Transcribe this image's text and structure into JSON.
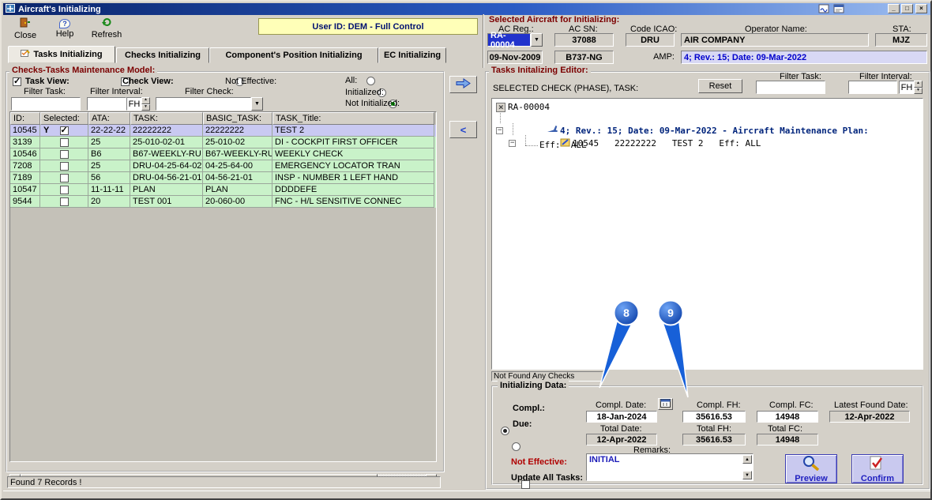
{
  "window": {
    "title": "Aircraft's Initializing"
  },
  "icons": {
    "dropdown": "▼",
    "up": "▲",
    "down": "▼",
    "left": "◄",
    "right": "►",
    "minimize": "_",
    "maximize": "□",
    "close": "×",
    "help": "?"
  },
  "toolbar": {
    "close": "Close",
    "help": "Help",
    "refresh": "Refresh",
    "banner": "User ID: DEM - Full Control"
  },
  "aircraft": {
    "title": "Selected Aircraft for Initializing:",
    "labels": {
      "ac_reg": "AC Reg.:",
      "ac_sn": "AC SN:",
      "code_icao": "Code ICAO:",
      "operator": "Operator Name:",
      "sta": "STA:",
      "amp": "AMP:"
    },
    "values": {
      "ac_reg": "RA-00004",
      "ac_sn": "37088",
      "code_icao": "DRU",
      "operator": "AIR COMPANY",
      "sta": "MJZ",
      "date": "09-Nov-2009",
      "actype": "B737-NG",
      "amp": "4; Rev.: 15; Date: 09-Mar-2022"
    }
  },
  "tabs": {
    "t1": "Tasks Initializing",
    "t2": "Checks Initializing",
    "t3": "Component's Position Initializing",
    "t4": "EC Initializing"
  },
  "model": {
    "title": "Checks-Tasks Maintenance Model:",
    "task_view": "Task View:",
    "check_view": "Check View:",
    "not_effective": "Not Effective:",
    "all": "All:",
    "initialized": "Initialized:",
    "not_initialized": "Not Initialized:",
    "filter_task": "Filter Task:",
    "filter_interval": "Filter Interval:",
    "filter_check": "Filter Check:",
    "fh": "FH",
    "cols": [
      "ID:",
      "Selected:",
      "ATA:",
      "TASK:",
      "BASIC_TASK:",
      "TASK_Title:"
    ],
    "rows": [
      {
        "id": "10545",
        "y": "Y",
        "ata": "22-22-22",
        "task": "22222222",
        "basic": "22222222",
        "title": "TEST 2"
      },
      {
        "id": "3139",
        "y": "",
        "ata": "25",
        "task": "25-010-02-01",
        "basic": "25-010-02",
        "title": "DI - COCKPIT FIRST OFFICER"
      },
      {
        "id": "10546",
        "y": "",
        "ata": "B6",
        "task": "B67-WEEKLY-RU",
        "basic": "B67-WEEKLY-RU",
        "title": "WEEKLY CHECK"
      },
      {
        "id": "7208",
        "y": "",
        "ata": "25",
        "task": "DRU-04-25-64-02",
        "basic": "04-25-64-00",
        "title": "EMERGENCY LOCATOR TRAN"
      },
      {
        "id": "7189",
        "y": "",
        "ata": "56",
        "task": "DRU-04-56-21-01",
        "basic": "04-56-21-01",
        "title": "INSP - NUMBER 1 LEFT HAND"
      },
      {
        "id": "10547",
        "y": "",
        "ata": "11-11-11",
        "task": "PLAN",
        "basic": "PLAN",
        "title": "DDDDEFE"
      },
      {
        "id": "9544",
        "y": "",
        "ata": "20",
        "task": "TEST 001",
        "basic": "20-060-00",
        "title": "FNC - H/L SENSITIVE CONNEC"
      }
    ],
    "status": "Found 7 Records !"
  },
  "mid": {
    "left": "<"
  },
  "editor": {
    "title": "Tasks Initalizing Editor:",
    "selected_label": "SELECTED CHECK (PHASE), TASK:",
    "reset": "Reset",
    "filter_task": "Filter Task:",
    "filter_interval": "Filter Interval:",
    "fh": "FH",
    "tree": {
      "root": "RA-00004",
      "plan": "4; Rev.: 15; Date: 09-Mar-2022 - Aircraft Maintenance Plan:",
      "task": "10545   22222222   TEST 2   Eff: ALL",
      "eff": "Eff:  ALL"
    },
    "not_found": "Not Found Any Checks",
    "init": {
      "title": "Initializing Data:",
      "compl": "Compl.:",
      "due": "Due:",
      "compl_date_label": "Compl. Date:",
      "compl_fh_label": "Compl. FH:",
      "compl_fc_label": "Compl. FC:",
      "latest_label": "Latest Found Date:",
      "compl_date": "18-Jan-2024",
      "compl_fh": "35616.53",
      "compl_fc": "14948",
      "latest_date": "12-Apr-2022",
      "total_date_label": "Total Date:",
      "total_fh_label": "Total FH:",
      "total_fc_label": "Total FC:",
      "total_date": "12-Apr-2022",
      "total_fh": "35616.53",
      "total_fc": "14948",
      "remarks_label": "Remarks:",
      "remarks": "INITIAL",
      "not_effective": "Not Effective:",
      "update_all": "Update All Tasks:",
      "preview": "Preview",
      "confirm": "Confirm"
    }
  },
  "callouts": {
    "c8": "8",
    "c9": "9"
  }
}
